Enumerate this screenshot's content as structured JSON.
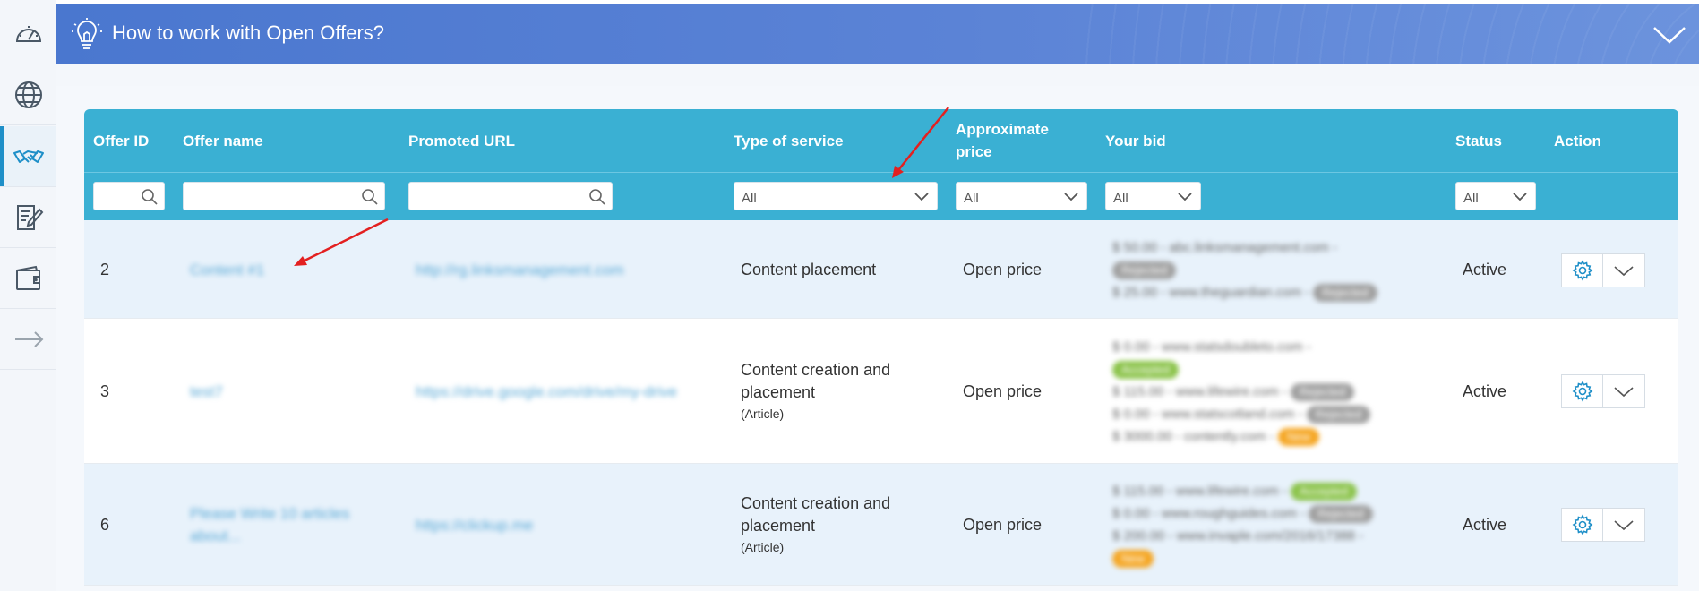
{
  "banner": {
    "title": "How to work with Open Offers?"
  },
  "sidebar": {
    "items": [
      {
        "icon": "speedometer-icon"
      },
      {
        "icon": "globe-icon"
      },
      {
        "icon": "handshake-icon",
        "active": true
      },
      {
        "icon": "edit-document-icon"
      },
      {
        "icon": "wallet-icon"
      },
      {
        "icon": "arrow-right-icon"
      }
    ]
  },
  "table": {
    "headers": {
      "offer_id": "Offer ID",
      "offer_name": "Offer name",
      "promoted_url": "Promoted URL",
      "type_of_service": "Type of service",
      "approximate_price_line1": "Approximate",
      "approximate_price_line2": "price",
      "your_bid": "Your bid",
      "status": "Status",
      "action": "Action"
    },
    "filters": {
      "type_of_service": "All",
      "approximate_price": "All",
      "your_bid": "All",
      "status": "All"
    },
    "rows": [
      {
        "id": "2",
        "name": "Content #1",
        "url": "http://rg.linksmanagement.com",
        "service": "Content placement",
        "service_sub": "",
        "price": "Open price",
        "bids": [
          {
            "text": "$ 50.00 - abc.linksmanagement.com -",
            "pill": "Rejected",
            "pill_color": "grey",
            "pill_newline": true
          },
          {
            "text": "$ 25.00 - www.theguardian.com -",
            "pill": "Rejected",
            "pill_color": "grey",
            "pill_newline": false
          }
        ],
        "status": "Active"
      },
      {
        "id": "3",
        "name": "test7",
        "url": "https://drive.google.com/drive/my-drive",
        "service": "Content creation and placement",
        "service_sub": "(Article)",
        "price": "Open price",
        "bids": [
          {
            "text": "$ 0.00 - www.statsdoubleto.com -",
            "pill": "Accepted",
            "pill_color": "green",
            "pill_newline": true
          },
          {
            "text": "$ 115.00 - www.lifewire.com -",
            "pill": "Rejected",
            "pill_color": "grey",
            "pill_newline": false
          },
          {
            "text": "$ 0.00 - www.statscotland.com -",
            "pill": "Rejected",
            "pill_color": "grey",
            "pill_newline": false
          },
          {
            "text": "$ 3000.00 - contently.com -",
            "pill": "New",
            "pill_color": "orange",
            "pill_newline": false
          }
        ],
        "status": "Active"
      },
      {
        "id": "6",
        "name": "Please Write 10 articles about...",
        "url": "https://clickup.me",
        "service": "Content creation and placement",
        "service_sub": "(Article)",
        "price": "Open price",
        "bids": [
          {
            "text": "$ 115.00 - www.lifewire.com -",
            "pill": "Accepted",
            "pill_color": "green",
            "pill_newline": false
          },
          {
            "text": "$ 0.00 - www.roughguides.com -",
            "pill": "Rejected",
            "pill_color": "grey",
            "pill_newline": false
          },
          {
            "text": "$ 200.00 - www.invaple.com/2016/17388 -",
            "pill": "New",
            "pill_color": "orange",
            "pill_newline": true
          }
        ],
        "status": "Active"
      }
    ]
  },
  "colors": {
    "banner": "#4a77cf",
    "table_header": "#3ab0d3",
    "accent": "#1e8fc8",
    "annotation_arrow": "#e32020"
  }
}
